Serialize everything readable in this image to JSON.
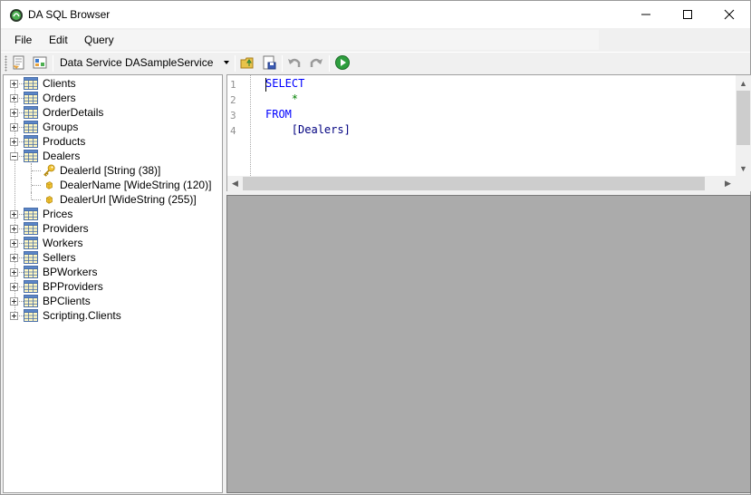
{
  "window": {
    "title": "DA SQL Browser",
    "controls": {
      "minimize": "—",
      "maximize": "☐",
      "close": "✕"
    }
  },
  "menu": {
    "items": [
      "File",
      "Edit",
      "Query"
    ]
  },
  "toolbar": {
    "data_service_label": "Data Service",
    "data_service_value": "DASampleService"
  },
  "tree": {
    "tables_before": [
      "Clients",
      "Orders",
      "OrderDetails",
      "Groups",
      "Products"
    ],
    "expanded": {
      "name": "Dealers",
      "fields": [
        {
          "label": "DealerId [String (38)]",
          "icon": "key-icon"
        },
        {
          "label": "DealerName [WideString (120)]",
          "icon": "field-icon"
        },
        {
          "label": "DealerUrl [WideString (255)]",
          "icon": "field-icon"
        }
      ]
    },
    "tables_after": [
      "Prices",
      "Providers",
      "Workers",
      "Sellers",
      "BPWorkers",
      "BPProviders",
      "BPClients",
      "Scripting.Clients"
    ]
  },
  "editor": {
    "line_numbers": [
      "1",
      "2",
      "3",
      "4"
    ],
    "lines": [
      {
        "text": "SELECT",
        "kind": "kw",
        "indent": 0
      },
      {
        "text": "*",
        "kind": "sym",
        "indent": 4
      },
      {
        "text": "FROM",
        "kind": "kw",
        "indent": 0
      },
      {
        "text": "[Dealers]",
        "kind": "ident",
        "indent": 4
      }
    ]
  },
  "colors": {
    "keyword": "#0000ff",
    "symbol": "#008000",
    "identifier": "#000080",
    "results_background": "#ababab"
  }
}
